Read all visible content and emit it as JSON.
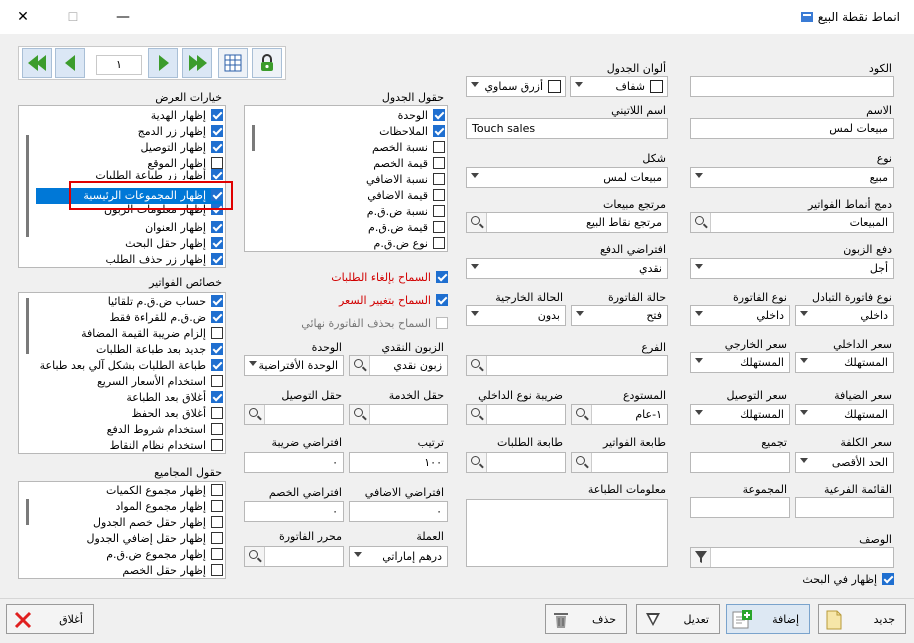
{
  "window": {
    "title": "انماط نقطة البيع",
    "close_glyph": "✕",
    "minimize_glyph": "☐",
    "maximize_glyph": "—"
  },
  "nav": {
    "page": "١"
  },
  "fields": {
    "code_label": "الكود",
    "code_value": "",
    "name_label": "الاسم",
    "name_value": "مبيعات لمس",
    "latin_label": "اسم اللاتيني",
    "latin_value": "Touch sales",
    "type_label": "نوع",
    "type_value": "مبيع",
    "shape_label": "شكل",
    "shape_value": "مبيعات لمس",
    "merge_label": "دمج أنماط الفواتير",
    "merge_value": "المبيعات",
    "sales_ref_label": "مرتجع مبيعات",
    "sales_ref_value": "مرتجع نقاط البيع",
    "pay_label": "دفع الزبون",
    "pay_value": "أجل",
    "default_pay_label": "افتراضي الدفع",
    "default_pay_value": "نقدي",
    "exch_inv_label": "نوع فاتورة التبادل",
    "exch_inv_value": "داخلي",
    "inv_type_label": "نوع الفاتورة",
    "inv_type_value": "داخلي",
    "inv_state_label": "حالة الفاتورة",
    "inv_state_value": "فتح",
    "ext_state_label": "الحالة الخارجية",
    "ext_state_value": "بدون",
    "int_price_label": "سعر الداخلي",
    "int_price_value": "المستهلك",
    "ext_price_label": "سعر الخارجي",
    "ext_price_value": "المستهلك",
    "branch_label": "الفرع",
    "branch_value": "",
    "hosp_price_label": "سعر الضيافة",
    "hosp_price_value": "المستهلك",
    "deliv_price_label": "سعر التوصيل",
    "deliv_price_value": "المستهلك",
    "warehouse_label": "المستودع",
    "warehouse_value": "١-عام",
    "int_tax_label": "ضريبة نوع الداخلي",
    "int_tax_value": "",
    "cost_price_label": "سعر الكلفة",
    "cost_price_value": "الحد الأقصى",
    "group_label": "تجميع",
    "group_value": "",
    "inv_printer_label": "طابعة الفواتير",
    "inv_printer_value": "",
    "order_printer_label": "طابعة الطلبات",
    "order_printer_value": "",
    "sub_list_label": "القائمة الفرعية",
    "sub_list_value": "",
    "collection_label": "المجموعة",
    "collection_value": "",
    "print_info_label": "معلومات الطباعة",
    "print_info_value": "",
    "desc_label": "الوصف",
    "desc_value": "",
    "show_search_label": "إظهار في البحث",
    "table_colors_label": "ألوان الجدول",
    "color1_value": "شفاف",
    "color2_value": "أزرق سماوي",
    "cash_customer_label": "الزبون النقدي",
    "cash_customer_value": "زبون نقدي",
    "unit_label": "الوحدة",
    "unit_value": "الوحدة الأفتراضية",
    "service_field_label": "حقل الخدمة",
    "service_field_value": "",
    "delivery_field_label": "حقل التوصيل",
    "delivery_field_value": "",
    "order_label": "ترتيب",
    "order_value": "١٠٠",
    "def_tax_label": "افتراضي ضريبة",
    "def_tax_value": "٠",
    "def_extra_label": "افتراضي الاضافي",
    "def_extra_value": "٠",
    "def_discount_label": "افتراضي الخصم",
    "def_discount_value": "٠",
    "currency_label": "العملة",
    "currency_value": "درهم إماراتي",
    "inv_editor_label": "محرر الفاتورة",
    "inv_editor_value": ""
  },
  "options": {
    "cancel_orders": "السماح بإلغاء الطلبات",
    "change_price": "السماح بتغيير السعر",
    "delete_final": "السماح بحذف الفاتورة نهائي"
  },
  "display_options": {
    "title": "خيارات العرض",
    "items": [
      "إظهار الهدية",
      "إظهار زر الدمج",
      "إظهار التوصيل",
      "إظهار الموقع",
      "إظهار زر طباعة الطلبات",
      "إظهار المجموعات الرئيسية",
      "إظهار معلومات الزبون",
      "إظهار العنوان",
      "إظهار حقل البحث",
      "إظهار زر حذف الطلب"
    ]
  },
  "table_fields": {
    "title": "حقول الجدول",
    "items": [
      "الوحدة",
      "الملاحظات",
      "نسبة الخصم",
      "قيمة الخصم",
      "نسبة الاضافي",
      "قيمة الاضافي",
      "نسبة ض.ق.م",
      "قيمة ض.ق.م",
      "نوع ض.ق.م"
    ]
  },
  "invoice_props": {
    "title": "خصائص الفواتير",
    "items": [
      "حساب ض.ق.م تلقائيا",
      "ض.ق.م للقراءة فقط",
      "إلزام ضريبة القيمة المضافة",
      "جديد بعد طباعة الطلبات",
      "طباعة الطلبات بشكل آلي بعد طباعة الفاتورة",
      "استخدام الأسعار السريع",
      "أغلاق بعد الطباعة",
      "أغلاق بعد الحفظ",
      "استخدام شروط الدفع",
      "استخدام نظام النقاط"
    ]
  },
  "totals_fields": {
    "title": "حقول المجاميع",
    "items": [
      "إظهار مجموع الكميات",
      "إظهار مجموع المواد",
      "إظهار حقل خصم الجدول",
      "إظهار حقل إضافي الجدول",
      "إظهار مجموع ض.ق.م",
      "إظهار حقل الخصم"
    ]
  },
  "buttons": {
    "new": "جديد",
    "add": "إضافة",
    "edit": "تعديل",
    "delete": "حذف",
    "close": "أغلاق"
  }
}
